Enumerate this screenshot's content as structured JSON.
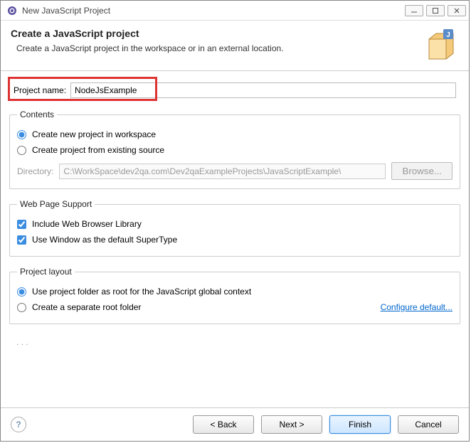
{
  "window": {
    "title": "New JavaScript Project"
  },
  "header": {
    "title": "Create a JavaScript project",
    "subtitle": "Create a JavaScript project in the workspace or in an external location."
  },
  "projectName": {
    "label": "Project name:",
    "value": "NodeJsExample"
  },
  "contents": {
    "legend": "Contents",
    "optNew": "Create new project in workspace",
    "optExisting": "Create project from existing source",
    "directoryLabel": "Directory:",
    "directoryValue": "C:\\WorkSpace\\dev2qa.com\\Dev2qaExampleProjects\\JavaScriptExample\\",
    "browse": "Browse..."
  },
  "webSupport": {
    "legend": "Web Page Support",
    "chkLibrary": "Include Web Browser Library",
    "chkSuperType": "Use Window as the default SuperType"
  },
  "layout": {
    "legend": "Project layout",
    "optRoot": "Use project folder as root for the JavaScript global context",
    "optSeparate": "Create a separate root folder",
    "configure": "Configure default..."
  },
  "footer": {
    "back": "< Back",
    "next": "Next >",
    "finish": "Finish",
    "cancel": "Cancel"
  }
}
